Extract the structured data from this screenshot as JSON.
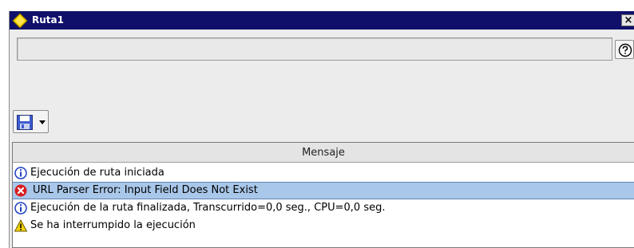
{
  "window": {
    "title": "Ruta1",
    "close_label": "×"
  },
  "status": {
    "text": ""
  },
  "toolbar": {
    "help_icon": "help-icon",
    "save_icon": "save-disk-icon"
  },
  "log": {
    "column_header": "Mensaje",
    "rows": [
      {
        "type": "info",
        "icon": "info-icon",
        "text": "Ejecución de ruta iniciada",
        "selected": false
      },
      {
        "type": "error",
        "icon": "error-icon",
        "text": "URL Parser Error: Input Field Does Not Exist",
        "selected": true
      },
      {
        "type": "info",
        "icon": "info-icon",
        "text": "Ejecución de la ruta finalizada, Transcurrido=0,0 seg., CPU=0,0 seg.",
        "selected": false
      },
      {
        "type": "warning",
        "icon": "warning-icon",
        "text": "Se ha interrumpido la ejecución",
        "selected": false
      }
    ]
  },
  "colors": {
    "titlebar": "#10106b",
    "selection": "#a9c7e9",
    "info": "#1e3fbf",
    "error": "#d81d1d",
    "warning": "#f3d200"
  }
}
